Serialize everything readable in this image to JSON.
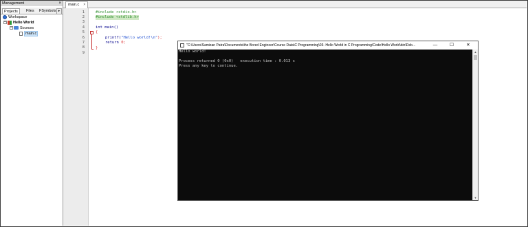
{
  "management": {
    "title": "Management",
    "close_glyph": "×",
    "tabs": [
      "Projects",
      "Files",
      "FSymbols"
    ],
    "tab_arrow": "▸",
    "tree": {
      "workspace": "Workspace",
      "project": "Hello World",
      "folder": "Sources",
      "file": "main.c",
      "expand_glyph": "−"
    }
  },
  "editor": {
    "tab_label": "main.c",
    "tab_close": "×",
    "line_numbers": [
      "1",
      "2",
      "3",
      "4",
      "5",
      "6",
      "7",
      "8",
      "9"
    ],
    "lines": {
      "l1_inc": "#include",
      "l1_hdr": "<stdio.h>",
      "l2_inc": "#include",
      "l2_hdr": "<stdlib.h>",
      "l4": "int main()",
      "l5": "{",
      "l6_fn": "printf(",
      "l6_str": "\"Hello world!\\n\"",
      "l6_end": ");",
      "l7_kw": "return",
      "l7_num": "0",
      "l7_end": ";",
      "l8": "}"
    },
    "fold_glyph": "−"
  },
  "console": {
    "title": "\"C:\\Users\\Samizan Patra\\Documents\\the Bored Engineer\\Course Data\\C Programming\\03- Hello World in C Programming\\Code\\Hello World\\bin\\Deb...",
    "minimize": "—",
    "maximize": "☐",
    "close": "✕",
    "output": "Hello world!\n\nProcess returned 0 (0x0)   execution time : 0.013 s\nPress any key to continue.",
    "scroll_up": "▲",
    "scroll_down": "▼"
  }
}
